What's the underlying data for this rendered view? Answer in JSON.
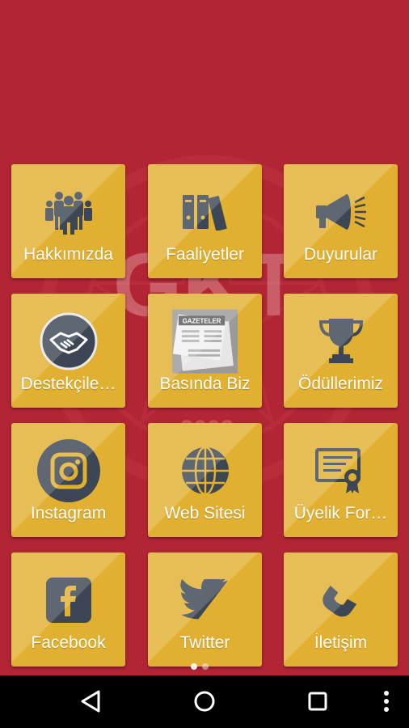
{
  "tiles": [
    {
      "label": "Hakkımızda",
      "icon": "team-icon"
    },
    {
      "label": "Faaliyetler",
      "icon": "binders-icon"
    },
    {
      "label": "Duyurular",
      "icon": "megaphone-icon"
    },
    {
      "label": "Destekçile…",
      "icon": "handshake-icon"
    },
    {
      "label": "Basında Biz",
      "icon": "newspaper-image"
    },
    {
      "label": "Ödüllerimiz",
      "icon": "trophy-icon"
    },
    {
      "label": "Instagram",
      "icon": "instagram-icon"
    },
    {
      "label": "Web Sitesi",
      "icon": "globe-icon"
    },
    {
      "label": "Üyelik For…",
      "icon": "certificate-icon"
    },
    {
      "label": "Facebook",
      "icon": "facebook-icon"
    },
    {
      "label": "Twitter",
      "icon": "twitter-icon"
    },
    {
      "label": "İletişim",
      "icon": "phone-icon"
    }
  ],
  "newspaper_text": "GAZETELER",
  "colors": {
    "background": "#b12535",
    "tile": "#e2b030",
    "icon": "#3c4654",
    "label": "#ffffff"
  },
  "pager": {
    "pages": 2,
    "current": 1
  },
  "navbar": {
    "back": "back-icon",
    "home": "home-icon",
    "recents": "recents-icon",
    "menu": "more-icon"
  }
}
